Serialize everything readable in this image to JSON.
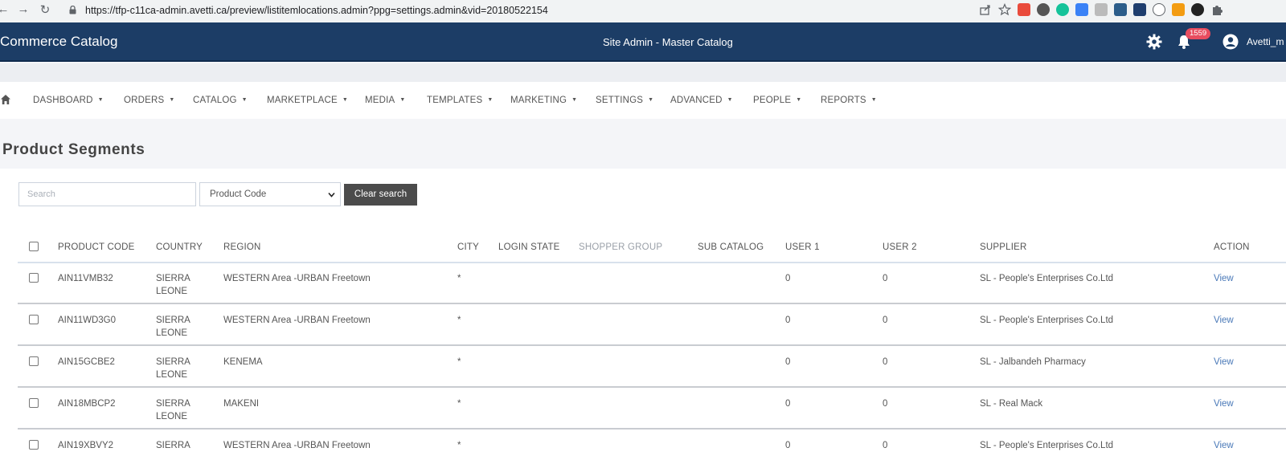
{
  "browser": {
    "url": "https://tfp-c11ca-admin.avetti.ca/preview/listitemlocations.admin?ppg=settings.admin&vid=20180522154",
    "nav": [
      "←",
      "→",
      "↻"
    ]
  },
  "header": {
    "brand": "Commerce Catalog",
    "site_title": "Site Admin - Master Catalog",
    "notification_count": "1559",
    "user_name": "Avetti_m",
    "colors": {
      "header_bg": "#1c3d66",
      "badge": "#e84d5f",
      "link": "#4a79b8"
    }
  },
  "menu": {
    "items": [
      "DASHBOARD",
      "ORDERS",
      "CATALOG",
      "MARKETPLACE",
      "MEDIA",
      "TEMPLATES",
      "MARKETING",
      "SETTINGS",
      "ADVANCED",
      "PEOPLE",
      "REPORTS"
    ]
  },
  "page": {
    "title": "Product Segments"
  },
  "filters": {
    "search_placeholder": "Search",
    "select_value": "Product Code",
    "clear_label": "Clear search"
  },
  "table": {
    "headers": [
      "PRODUCT CODE",
      "COUNTRY",
      "REGION",
      "CITY",
      "LOGIN STATE",
      "SHOPPER GROUP",
      "SUB CATALOG",
      "USER 1",
      "USER 2",
      "SUPPLIER",
      "ACTION"
    ],
    "rows": [
      {
        "code": "AIN11VMB32",
        "country_1": "SIERRA",
        "country_2": "LEONE",
        "region": "WESTERN Area -URBAN Freetown",
        "city": "*",
        "user1": "0",
        "user2": "0",
        "supplier": "SL - People's Enterprises Co.Ltd",
        "action": "View"
      },
      {
        "code": "AIN11WD3G0",
        "country_1": "SIERRA",
        "country_2": "LEONE",
        "region": "WESTERN Area -URBAN Freetown",
        "city": "*",
        "user1": "0",
        "user2": "0",
        "supplier": "SL - People's Enterprises Co.Ltd",
        "action": "View"
      },
      {
        "code": "AIN15GCBE2",
        "country_1": "SIERRA",
        "country_2": "LEONE",
        "region": "KENEMA",
        "city": "*",
        "user1": "0",
        "user2": "0",
        "supplier": "SL - Jalbandeh Pharmacy",
        "action": "View"
      },
      {
        "code": "AIN18MBCP2",
        "country_1": "SIERRA",
        "country_2": "LEONE",
        "region": "MAKENI",
        "city": "*",
        "user1": "0",
        "user2": "0",
        "supplier": "SL - Real Mack",
        "action": "View"
      },
      {
        "code": "AIN19XBVY2",
        "country_1": "SIERRA",
        "country_2": "",
        "region": "WESTERN Area -URBAN Freetown",
        "city": "*",
        "user1": "0",
        "user2": "0",
        "supplier": "SL - People's Enterprises Co.Ltd",
        "action": "View"
      }
    ]
  }
}
